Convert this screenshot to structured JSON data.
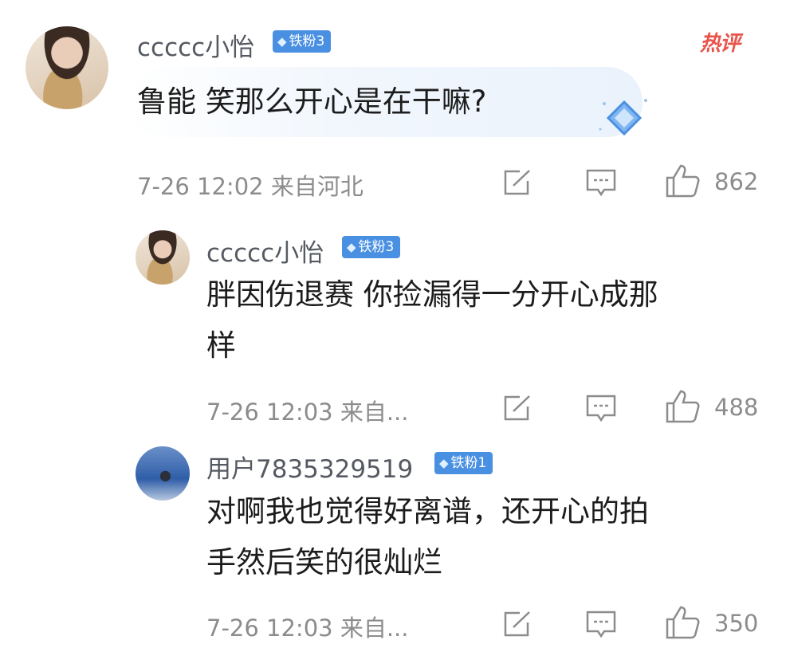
{
  "hot_label": "热评",
  "comments": [
    {
      "username": "ccccc小怡",
      "badge": "铁粉3",
      "text": "鲁能  笑那么开心是在干嘛?",
      "meta": "7-26 12:02 来自河北",
      "likes": "862"
    },
    {
      "username": "ccccc小怡",
      "badge": "铁粉3",
      "text_line1": "胖因伤退赛 你捡漏得一分开心成那",
      "text_line2": "样",
      "meta": "7-26 12:03 来自...",
      "likes": "488"
    },
    {
      "username": "用户7835329519",
      "badge": "铁粉1",
      "text_line1": "对啊我也觉得好离谱，还开心的拍",
      "text_line2": "手然后笑的很灿烂",
      "meta": "7-26 12:03 来自...",
      "likes": "350"
    }
  ],
  "icons": {
    "badge": "diamond-icon",
    "share": "share-icon",
    "reply": "comment-icon",
    "like": "thumbs-up-icon"
  },
  "colors": {
    "badge_bg": "#4a90e2",
    "hot": "#e8534b",
    "meta_text": "#8c8c8c"
  }
}
